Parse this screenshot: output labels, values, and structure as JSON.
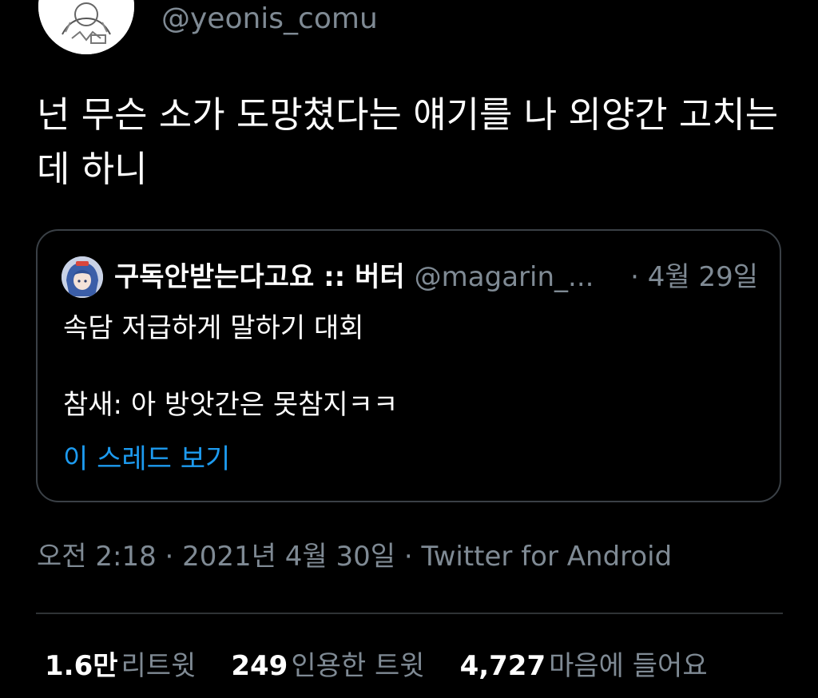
{
  "author": {
    "handle": "@yeonis_comu",
    "avatar_icon": "sketch-character-avatar"
  },
  "tweet": {
    "text": "넌 무슨 소가 도망쳤다는 얘기를 나 외양간 고치는데 하니"
  },
  "quote": {
    "avatar_icon": "anime-character-avatar",
    "name": "구독안받는다고요 :: 버터",
    "handle": "@magarin_...",
    "date": "· 4월 29일",
    "line1": "속담 저급하게 말하기 대회",
    "line2": "참새: 아 방앗간은 못참지ㅋㅋ",
    "thread_link": "이 스레드 보기"
  },
  "meta": {
    "text": "오전 2:18 · 2021년 4월 30일 · Twitter for Android"
  },
  "stats": {
    "retweets_count": "1.6만",
    "retweets_label": "리트윗",
    "quotes_count": "249",
    "quotes_label": "인용한 트윗",
    "likes_count": "4,727",
    "likes_label": "마음에 들어요"
  },
  "colors": {
    "background": "#000000",
    "text_primary": "#ffffff",
    "text_secondary": "#7f8a94",
    "link": "#1d9bf0",
    "border": "#3a4046"
  }
}
